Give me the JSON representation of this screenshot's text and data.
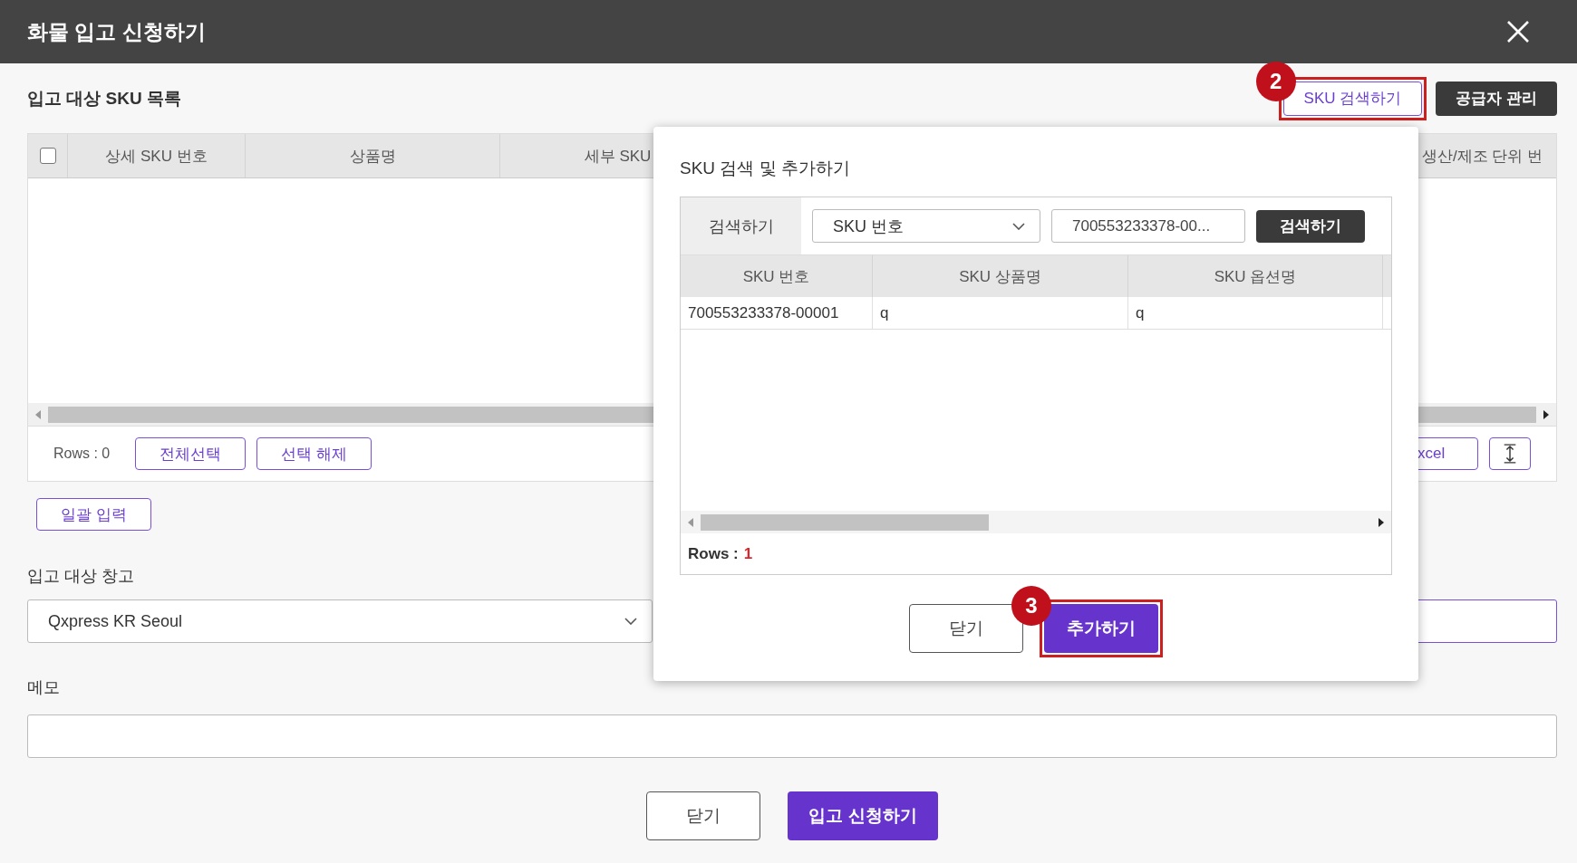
{
  "window": {
    "title": "화물 입고 신청하기"
  },
  "sku_list": {
    "title": "입고 대상 SKU 목록",
    "buttons": [
      {
        "label": "SKU 검색하기",
        "kind": "outline",
        "step": "2"
      },
      {
        "label": "공급자 관리",
        "kind": "dark"
      }
    ],
    "select_all_checked": false,
    "columns": [
      "상세 SKU 번호",
      "상품명",
      "세부 SKU",
      "",
      "생산/제조 단위 번"
    ],
    "rows_label": "Rows : 0",
    "footer_buttons": [
      "전체선택",
      "선택 해제"
    ],
    "export_button": "xcel",
    "bulk_input_button": "일괄 입력"
  },
  "warehouse": {
    "label": "입고 대상 창고",
    "value": "Qxpress KR Seoul"
  },
  "memo": {
    "label": "메모"
  },
  "actions": [
    {
      "label": "닫기",
      "kind": "secondary"
    },
    {
      "label": "입고 신청하기",
      "kind": "primary"
    }
  ],
  "sku_search_dialog": {
    "title": "SKU 검색 및 추가하기",
    "search_label": "검색하기",
    "search_type": "SKU 번호",
    "search_value": "700553233378-00...",
    "search_button": "검색하기",
    "columns": [
      "SKU 번호",
      "SKU 상품명",
      "SKU 옵션명"
    ],
    "rows": [
      [
        "700553233378-00001",
        "q",
        "q"
      ]
    ],
    "rows_label": "Rows :",
    "row_count": "1",
    "buttons": [
      {
        "label": "닫기",
        "kind": "secondary"
      },
      {
        "label": "추가하기",
        "kind": "primary",
        "step": "3"
      }
    ]
  }
}
